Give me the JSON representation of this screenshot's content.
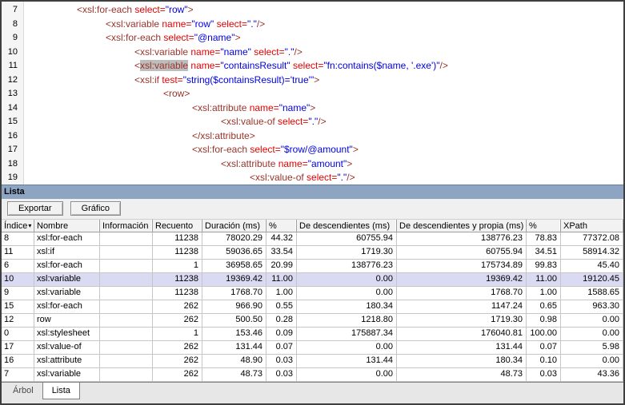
{
  "panel": {
    "title": "Lista"
  },
  "toolbar": {
    "buttons": [
      {
        "label": "Exportar"
      },
      {
        "label": "Gráfico"
      }
    ]
  },
  "code_editor": {
    "language": "xslt",
    "highlighted_text": "xsl:variable",
    "lines": [
      {
        "num": 7,
        "indent": 2,
        "tokens": [
          [
            "tag",
            "<xsl:for-each "
          ],
          [
            "attr",
            "select="
          ],
          [
            "val",
            "\"row\""
          ],
          [
            "tag",
            ">"
          ]
        ]
      },
      {
        "num": 8,
        "indent": 3,
        "tokens": [
          [
            "tag",
            "<xsl:variable "
          ],
          [
            "attr",
            "name="
          ],
          [
            "val",
            "\"row\""
          ],
          [
            "tag",
            " "
          ],
          [
            "attr",
            "select="
          ],
          [
            "val",
            "\".\""
          ],
          [
            "tag",
            "/>"
          ]
        ]
      },
      {
        "num": 9,
        "indent": 3,
        "tokens": [
          [
            "tag",
            "<xsl:for-each "
          ],
          [
            "attr",
            "select="
          ],
          [
            "val",
            "\"@name\""
          ],
          [
            "tag",
            ">"
          ]
        ]
      },
      {
        "num": 10,
        "indent": 4,
        "tokens": [
          [
            "tag",
            "<xsl:variable "
          ],
          [
            "attr",
            "name="
          ],
          [
            "val",
            "\"name\""
          ],
          [
            "tag",
            " "
          ],
          [
            "attr",
            "select="
          ],
          [
            "val",
            "\".\""
          ],
          [
            "tag",
            "/>"
          ]
        ]
      },
      {
        "num": 11,
        "indent": 4,
        "tokens": [
          [
            "tag",
            "<"
          ],
          [
            "hl",
            "xsl:variable"
          ],
          [
            "tag",
            " "
          ],
          [
            "attr",
            "name="
          ],
          [
            "val",
            "\"containsResult\""
          ],
          [
            "tag",
            " "
          ],
          [
            "attr",
            "select="
          ],
          [
            "val",
            "\"fn:contains($name, '.exe')\""
          ],
          [
            "tag",
            "/>"
          ]
        ]
      },
      {
        "num": 12,
        "indent": 4,
        "tokens": [
          [
            "tag",
            "<xsl:if "
          ],
          [
            "attr",
            "test="
          ],
          [
            "val",
            "\"string($containsResult)='true'\""
          ],
          [
            "tag",
            ">"
          ]
        ]
      },
      {
        "num": 13,
        "indent": 5,
        "tokens": [
          [
            "tag",
            "<row>"
          ]
        ]
      },
      {
        "num": 14,
        "indent": 6,
        "tokens": [
          [
            "tag",
            "<xsl:attribute "
          ],
          [
            "attr",
            "name="
          ],
          [
            "val",
            "\"name\""
          ],
          [
            "tag",
            ">"
          ]
        ]
      },
      {
        "num": 15,
        "indent": 7,
        "tokens": [
          [
            "tag",
            "<xsl:value-of "
          ],
          [
            "attr",
            "select="
          ],
          [
            "val",
            "\".\""
          ],
          [
            "tag",
            "/>"
          ]
        ]
      },
      {
        "num": 16,
        "indent": 6,
        "tokens": [
          [
            "tag",
            "</xsl:attribute>"
          ]
        ]
      },
      {
        "num": 17,
        "indent": 6,
        "tokens": [
          [
            "tag",
            "<xsl:for-each "
          ],
          [
            "attr",
            "select="
          ],
          [
            "val",
            "\"$row/@amount\""
          ],
          [
            "tag",
            ">"
          ]
        ]
      },
      {
        "num": 18,
        "indent": 7,
        "tokens": [
          [
            "tag",
            "<xsl:attribute "
          ],
          [
            "attr",
            "name="
          ],
          [
            "val",
            "\"amount\""
          ],
          [
            "tag",
            ">"
          ]
        ]
      },
      {
        "num": 19,
        "indent": 8,
        "tokens": [
          [
            "tag",
            "<xsl:value-of "
          ],
          [
            "attr",
            "select="
          ],
          [
            "val",
            "\".\""
          ],
          [
            "tag",
            "/>"
          ]
        ]
      }
    ]
  },
  "table": {
    "columns": [
      {
        "key": "indice",
        "label": "Índice",
        "sorted": true
      },
      {
        "key": "nombre",
        "label": "Nombre"
      },
      {
        "key": "informacion",
        "label": "Información"
      },
      {
        "key": "recuento",
        "label": "Recuento"
      },
      {
        "key": "duracion_ms",
        "label": "Duración (ms)"
      },
      {
        "key": "pct",
        "label": "%"
      },
      {
        "key": "de_descendientes_ms",
        "label": "De descendientes (ms)"
      },
      {
        "key": "de_descendientes_y_propia_ms",
        "label": "De descendientes y propia (ms)"
      },
      {
        "key": "pct2",
        "label": "%"
      },
      {
        "key": "xpath",
        "label": "XPath"
      }
    ],
    "rows": [
      {
        "selected": false,
        "cells": [
          "8",
          "xsl:for-each",
          "",
          "11238",
          "78020.29",
          "44.32",
          "60755.94",
          "138776.23",
          "78.83",
          "77372.08"
        ]
      },
      {
        "selected": false,
        "cells": [
          "11",
          "xsl:if",
          "",
          "11238",
          "59036.65",
          "33.54",
          "1719.30",
          "60755.94",
          "34.51",
          "58914.32"
        ]
      },
      {
        "selected": false,
        "cells": [
          "6",
          "xsl:for-each",
          "",
          "1",
          "36958.65",
          "20.99",
          "138776.23",
          "175734.89",
          "99.83",
          "45.40"
        ]
      },
      {
        "selected": true,
        "cells": [
          "10",
          "xsl:variable",
          "",
          "11238",
          "19369.42",
          "11.00",
          "0.00",
          "19369.42",
          "11.00",
          "19120.45"
        ]
      },
      {
        "selected": false,
        "cells": [
          "9",
          "xsl:variable",
          "",
          "11238",
          "1768.70",
          "1.00",
          "0.00",
          "1768.70",
          "1.00",
          "1588.65"
        ]
      },
      {
        "selected": false,
        "cells": [
          "15",
          "xsl:for-each",
          "",
          "262",
          "966.90",
          "0.55",
          "180.34",
          "1147.24",
          "0.65",
          "963.30"
        ]
      },
      {
        "selected": false,
        "cells": [
          "12",
          "row",
          "",
          "262",
          "500.50",
          "0.28",
          "1218.80",
          "1719.30",
          "0.98",
          "0.00"
        ]
      },
      {
        "selected": false,
        "cells": [
          "0",
          "xsl:stylesheet",
          "",
          "1",
          "153.46",
          "0.09",
          "175887.34",
          "176040.81",
          "100.00",
          "0.00"
        ]
      },
      {
        "selected": false,
        "cells": [
          "17",
          "xsl:value-of",
          "",
          "262",
          "131.44",
          "0.07",
          "0.00",
          "131.44",
          "0.07",
          "5.98"
        ]
      },
      {
        "selected": false,
        "cells": [
          "16",
          "xsl:attribute",
          "",
          "262",
          "48.90",
          "0.03",
          "131.44",
          "180.34",
          "0.10",
          "0.00"
        ]
      },
      {
        "selected": false,
        "cells": [
          "7",
          "xsl:variable",
          "",
          "262",
          "48.73",
          "0.03",
          "0.00",
          "48.73",
          "0.03",
          "43.36"
        ]
      }
    ]
  },
  "tabs": [
    {
      "label": "Árbol",
      "active": false
    },
    {
      "label": "Lista",
      "active": true
    }
  ],
  "colors": {
    "tag": "#98342b",
    "attr": "#e60000",
    "val": "#0000e0",
    "title-bar": "#8da5c2",
    "selection": "#dadaf2",
    "token-highlight": "#bdbdbd"
  }
}
